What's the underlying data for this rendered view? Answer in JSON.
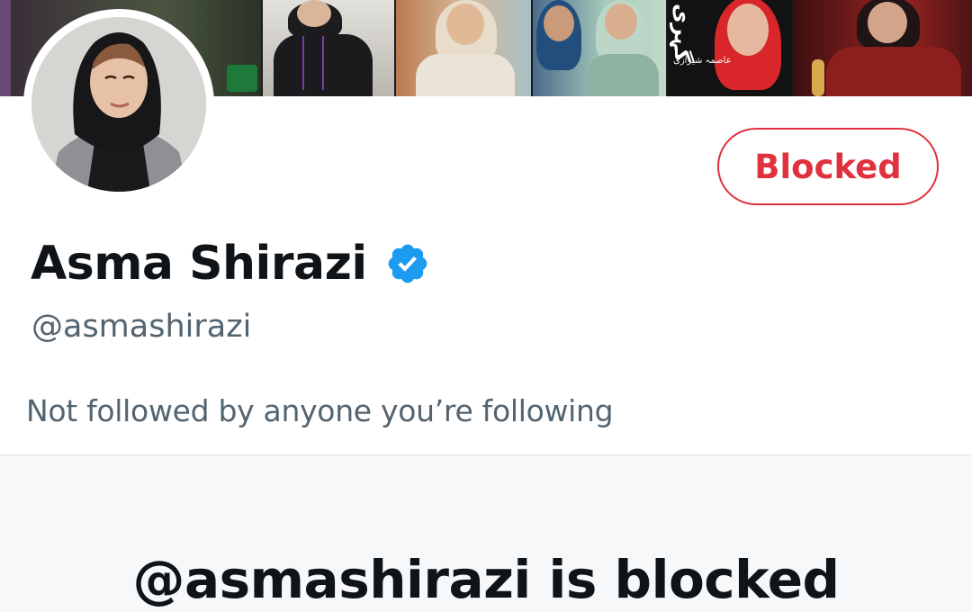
{
  "profile": {
    "display_name": "Asma Shirazi",
    "verified": true,
    "handle": "@asmashirazi",
    "followers_context": "Not followed by anyone you’re following"
  },
  "actions": {
    "blocked_label": "Blocked"
  },
  "blocked_notice": {
    "title": "@asmashirazi is blocked"
  },
  "banner": {
    "urdu_text": "گہری",
    "urdu_subtext": "عاصمہ شیرازی"
  },
  "colors": {
    "blocked_red": "#e0323e",
    "verified_blue": "#1d9bf0",
    "text_primary": "#0f1419",
    "text_secondary": "#536471"
  },
  "icons": {
    "verified": "verified-badge-icon"
  }
}
